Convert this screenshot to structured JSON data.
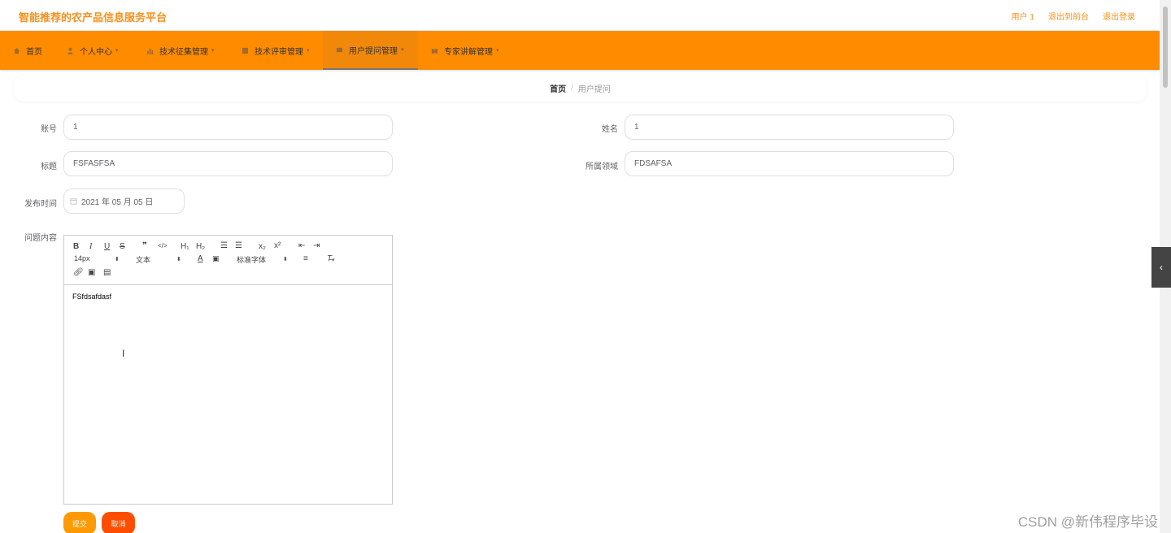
{
  "header": {
    "title": "智能推荐的农产品信息服务平台",
    "user": "用户 1",
    "to_front": "退出到前台",
    "logout": "退出登录"
  },
  "nav": {
    "items": [
      {
        "label": "首页",
        "icon": "home-icon"
      },
      {
        "label": "个人中心",
        "icon": "user-icon"
      },
      {
        "label": "技术征集管理",
        "icon": "chart-icon"
      },
      {
        "label": "技术评审管理",
        "icon": "grid-icon"
      },
      {
        "label": "用户提问管理",
        "icon": "chat-icon",
        "active": true
      },
      {
        "label": "专家讲解管理",
        "icon": "book-icon"
      }
    ]
  },
  "breadcrumb": {
    "home": "首页",
    "separator": "/",
    "current": "用户提问"
  },
  "form": {
    "account_label": "账号",
    "account_value": "1",
    "name_label": "姓名",
    "name_value": "1",
    "title_label": "标题",
    "title_value": "FSFASFSA",
    "field_label": "所属领域",
    "field_value": "FDSAFSA",
    "date_label": "发布时间",
    "date_value": "2021 年 05 月 05 日",
    "content_label": "问题内容"
  },
  "editor": {
    "font_size": "14px",
    "header_select": "文本",
    "font_family": "标准字体",
    "content": "FSfdsafdasf"
  },
  "buttons": {
    "submit": "提交",
    "cancel": "取消"
  },
  "watermark": "CSDN @新伟程序毕设",
  "colors": {
    "primary": "#ff8c00",
    "title": "#f6901b",
    "cancel": "#ff4d00"
  }
}
